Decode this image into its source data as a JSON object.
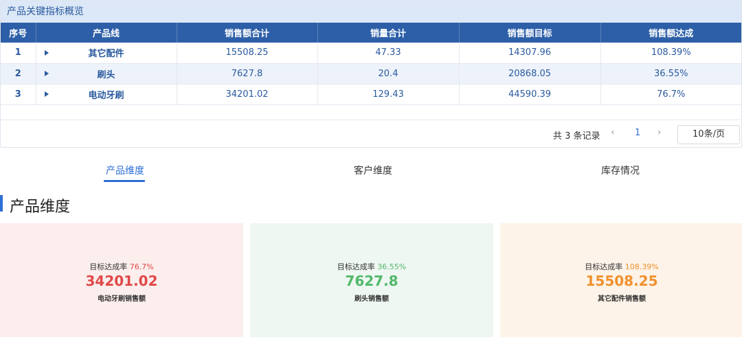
{
  "panel": {
    "title": "产品关键指标概览"
  },
  "table": {
    "headers": [
      "序号",
      "产品线",
      "销售额合计",
      "销量合计",
      "销售额目标",
      "销售额达成"
    ],
    "rows": [
      {
        "index": "1",
        "product": "其它配件",
        "sales_total": "15508.25",
        "qty_total": "47.33",
        "sales_target": "14307.96",
        "achievement": "108.39%"
      },
      {
        "index": "2",
        "product": "刷头",
        "sales_total": "7627.8",
        "qty_total": "20.4",
        "sales_target": "20868.05",
        "achievement": "36.55%"
      },
      {
        "index": "3",
        "product": "电动牙刷",
        "sales_total": "34201.02",
        "qty_total": "129.43",
        "sales_target": "44590.39",
        "achievement": "76.7%"
      }
    ]
  },
  "pager": {
    "total": "共 3 条记录",
    "prev": "‹",
    "current_page": "1",
    "next": "›",
    "page_size": "10条/页"
  },
  "tabs": [
    {
      "label": "产品维度",
      "active": true
    },
    {
      "label": "客户维度",
      "active": false
    },
    {
      "label": "库存情况",
      "active": false
    }
  ],
  "section": {
    "title": "产品维度"
  },
  "cards": [
    {
      "rate_label": "目标达成率",
      "rate": "76.7%",
      "value": "34201.02",
      "label": "电动牙刷销售额",
      "color": "#e04848",
      "bg": "#fbeeed"
    },
    {
      "rate_label": "目标达成率",
      "rate": "36.55%",
      "value": "7627.8",
      "label": "刷头销售额",
      "color": "#52b86c",
      "bg": "#eef7f1"
    },
    {
      "rate_label": "目标达成率",
      "rate": "108.39%",
      "value": "15508.25",
      "label": "其它配件销售额",
      "color": "#f0912f",
      "bg": "#fdf3e8"
    }
  ]
}
